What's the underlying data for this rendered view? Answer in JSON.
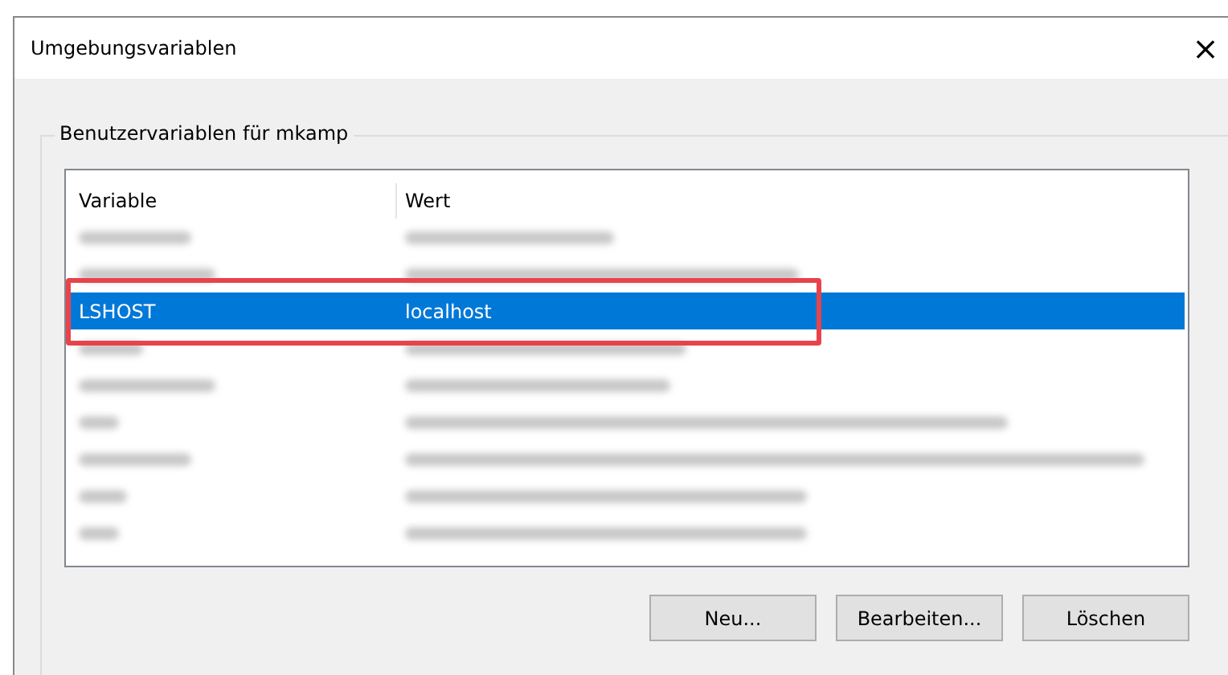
{
  "window": {
    "title": "Umgebungsvariablen",
    "close": "×"
  },
  "group": {
    "title": "Benutzervariablen für mkamp"
  },
  "table": {
    "columns": [
      "Variable",
      "Wert"
    ],
    "rows": [
      {
        "kind": "blurred",
        "selected": false,
        "outlined": false
      },
      {
        "kind": "blurred",
        "selected": false,
        "outlined": false
      },
      {
        "kind": "text",
        "variable": "LSHOST",
        "value": "localhost",
        "selected": true,
        "outlined": true
      },
      {
        "kind": "blurred",
        "selected": false,
        "outlined": false
      },
      {
        "kind": "blurred",
        "selected": false,
        "outlined": false
      },
      {
        "kind": "blurred",
        "selected": false,
        "outlined": false
      },
      {
        "kind": "blurred",
        "selected": false,
        "outlined": false
      },
      {
        "kind": "blurred",
        "selected": false,
        "outlined": false
      },
      {
        "kind": "blurred",
        "selected": false,
        "outlined": false
      }
    ]
  },
  "buttons": [
    "Neu...",
    "Bearbeiten...",
    "Löschen"
  ]
}
